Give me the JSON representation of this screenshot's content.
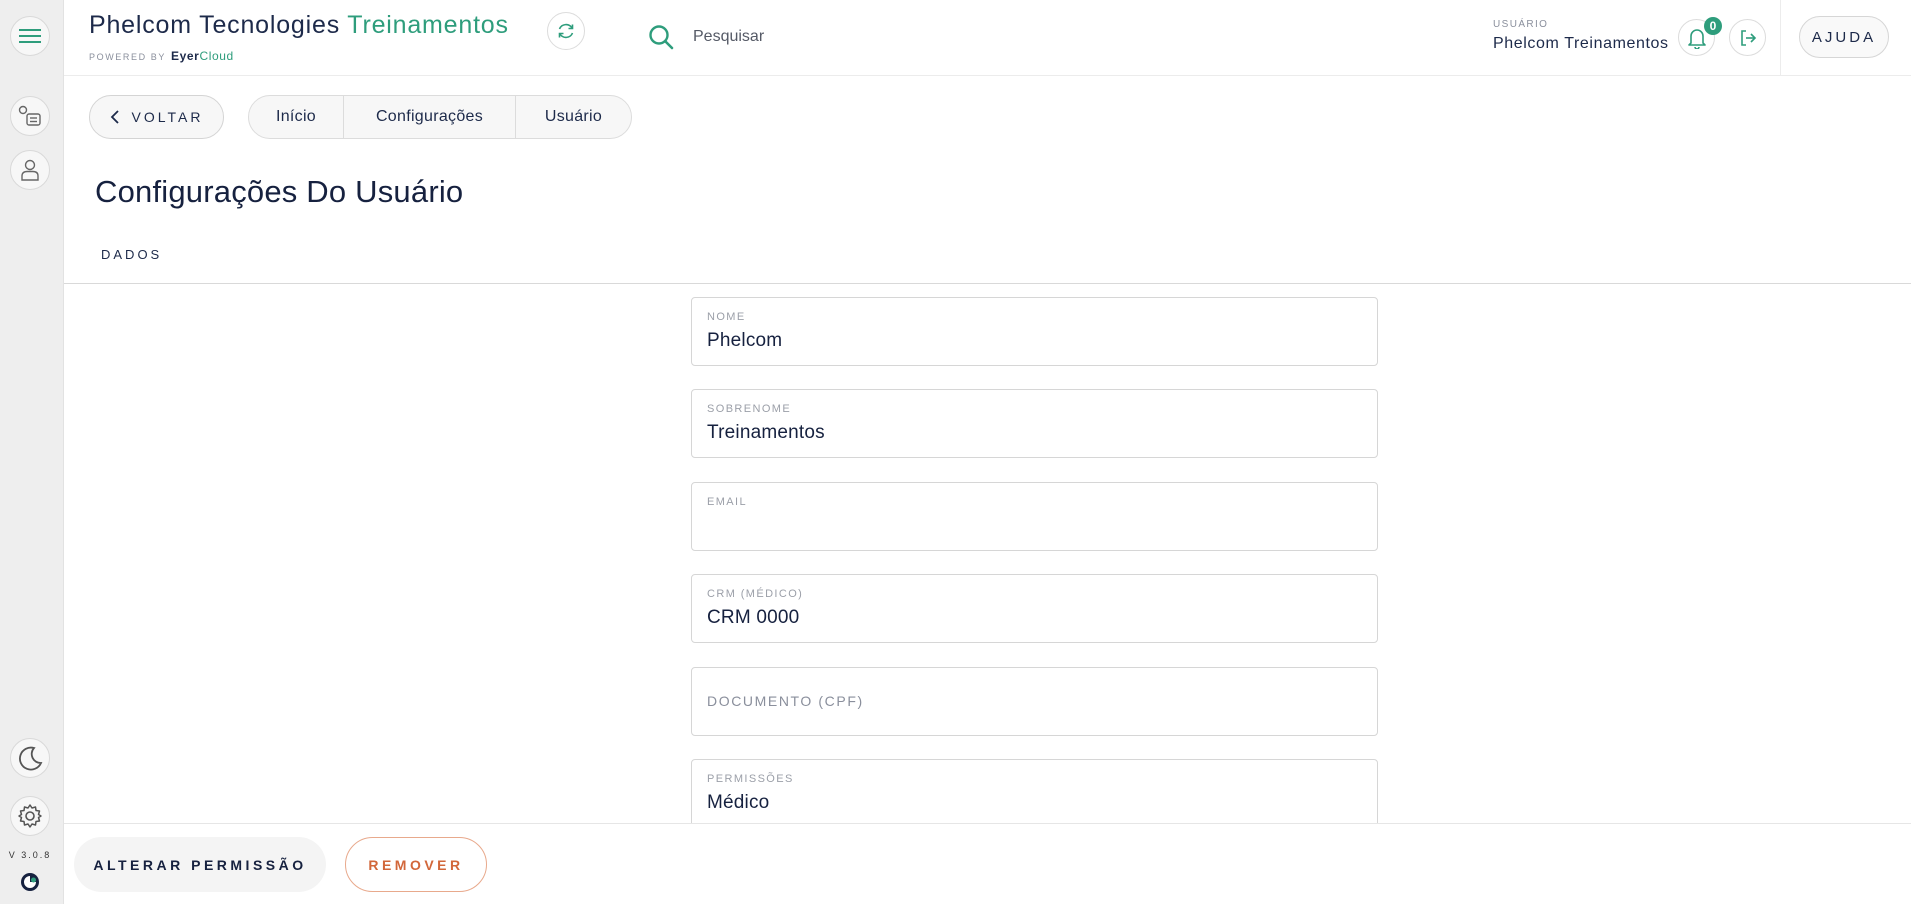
{
  "header": {
    "title_main": "Phelcom Tecnologies",
    "title_accent": "Treinamentos",
    "powered_by": "POWERED BY",
    "brand_eyer": "Eyer",
    "brand_cloud": "Cloud",
    "search_placeholder": "Pesquisar",
    "user_caption": "USUÁRIO",
    "user_name": "Phelcom Treinamentos",
    "notifications_count": "0",
    "help_label": "AJUDA"
  },
  "sidebar": {
    "version": "V 3.0.8",
    "icons": [
      "menu-icon",
      "list-icon",
      "user-icon",
      "moon-icon",
      "gear-icon",
      "brand-logo"
    ]
  },
  "nav": {
    "back_label": "VOLTAR",
    "breadcrumb": [
      "Início",
      "Configurações",
      "Usuário"
    ]
  },
  "page": {
    "title": "Configurações Do Usuário",
    "tab": "DADOS"
  },
  "form": {
    "fields": [
      {
        "label": "NOME",
        "value": "Phelcom"
      },
      {
        "label": "SOBRENOME",
        "value": "Treinamentos"
      },
      {
        "label": "EMAIL",
        "value": ""
      },
      {
        "label": "CRM (MÉDICO)",
        "value": "CRM 0000"
      },
      {
        "label": "DOCUMENTO (CPF)",
        "value": ""
      },
      {
        "label": "PERMISSÕES",
        "value": "Médico"
      }
    ]
  },
  "footer": {
    "change_permission": "ALTERAR PERMISSÃO",
    "remove": "REMOVER"
  },
  "colors": {
    "accent": "#2e9d7c",
    "text_dark": "#1d2a4a",
    "danger": "#d2673a",
    "sidebar_bg": "#eeeeee"
  }
}
